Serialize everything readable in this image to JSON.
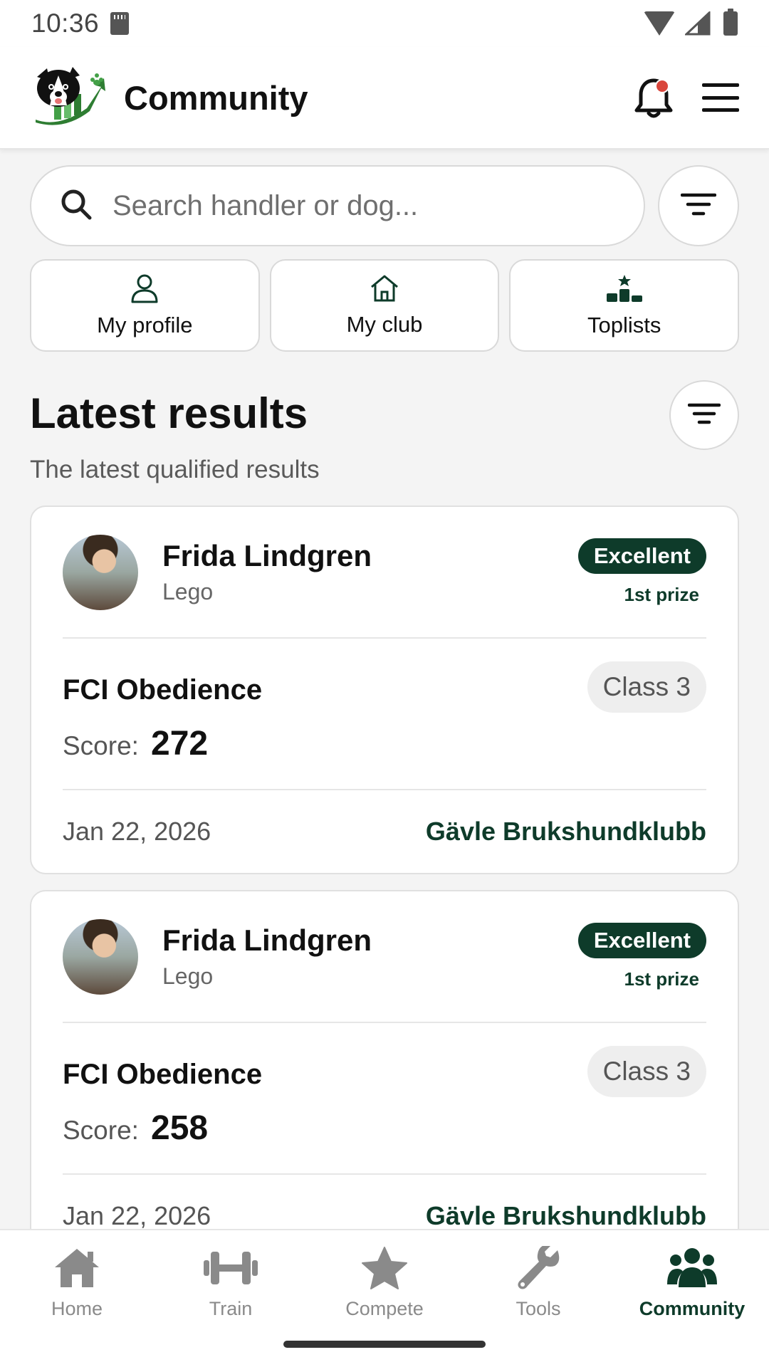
{
  "status_bar": {
    "time": "10:36"
  },
  "header": {
    "title": "Community",
    "logo": "community-logo",
    "notification_dot": true
  },
  "search": {
    "placeholder": "Search handler or dog..."
  },
  "quick_links": [
    {
      "label": "My profile",
      "icon": "person-icon"
    },
    {
      "label": "My club",
      "icon": "home-outline-icon"
    },
    {
      "label": "Toplists",
      "icon": "podium-icon"
    }
  ],
  "section": {
    "title": "Latest results",
    "subtitle": "The latest qualified results"
  },
  "results": [
    {
      "handler": "Frida Lindgren",
      "dog": "Lego",
      "badge": "Excellent",
      "prize": "1st prize",
      "event": "FCI Obedience",
      "class": "Class 3",
      "score_label": "Score:",
      "score": "272",
      "date": "Jan 22, 2026",
      "club": "Gävle Brukshundklubb"
    },
    {
      "handler": "Frida Lindgren",
      "dog": "Lego",
      "badge": "Excellent",
      "prize": "1st prize",
      "event": "FCI Obedience",
      "class": "Class 3",
      "score_label": "Score:",
      "score": "258",
      "date": "Jan 22, 2026",
      "club": "Gävle Brukshundklubb"
    }
  ],
  "bottom_nav": [
    {
      "label": "Home",
      "icon": "home-icon",
      "active": false
    },
    {
      "label": "Train",
      "icon": "dumbbell-icon",
      "active": false
    },
    {
      "label": "Compete",
      "icon": "star-icon",
      "active": false
    },
    {
      "label": "Tools",
      "icon": "wrench-icon",
      "active": false
    },
    {
      "label": "Community",
      "icon": "people-icon",
      "active": true
    }
  ],
  "colors": {
    "brand": "#0e3b2a",
    "notification": "#d9463c",
    "background": "#f4f4f4"
  }
}
